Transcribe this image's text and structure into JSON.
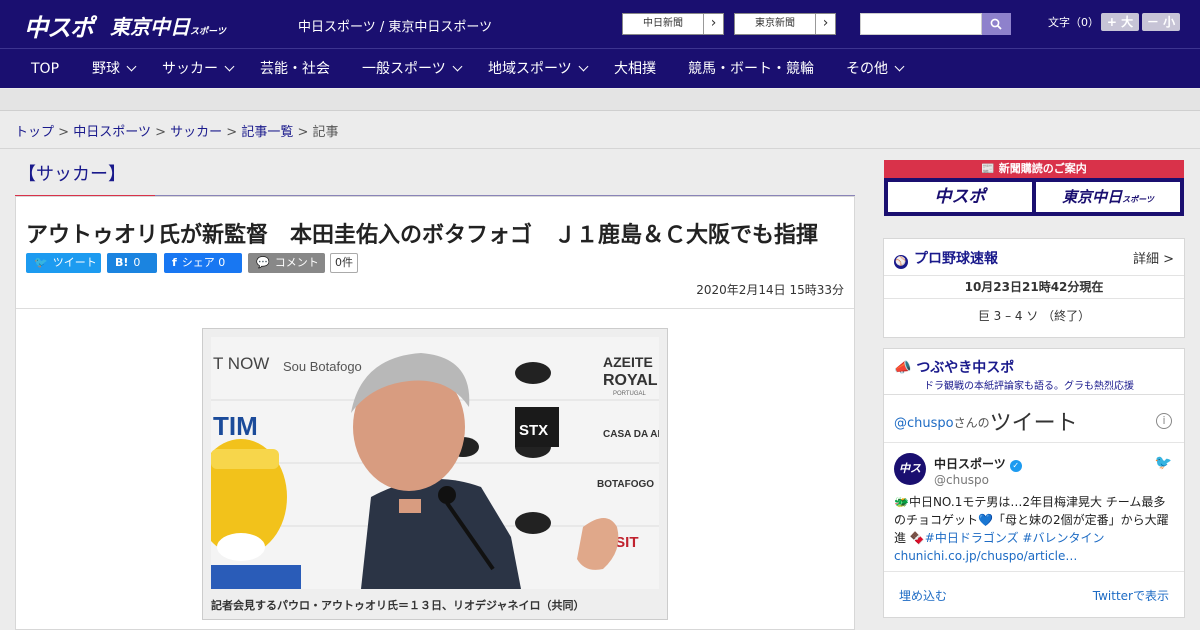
{
  "header": {
    "logo_chuspo": "中スポ",
    "logo_tokyo": "東京中日",
    "logo_tokyo_small": "スポーツ",
    "site_link": "中日スポーツ / 東京中日スポーツ",
    "news_buttons": [
      "中日新聞",
      "東京新聞"
    ],
    "search_placeholder": "",
    "font_label": "文字（0）",
    "font_plus": "+ 大",
    "font_minus": "－ 小"
  },
  "nav": [
    {
      "label": "TOP"
    },
    {
      "label": "野球"
    },
    {
      "label": "サッカー"
    },
    {
      "label": "芸能・社会"
    },
    {
      "label": "一般スポーツ"
    },
    {
      "label": "地域スポーツ"
    },
    {
      "label": "大相撲"
    },
    {
      "label": "競馬・ボート・競輪"
    },
    {
      "label": "その他"
    }
  ],
  "breadcrumb": [
    "トップ",
    "中日スポーツ",
    "サッカー",
    "記事一覧",
    "記事"
  ],
  "breadcrumb_sep": ">",
  "section_title": "【サッカー】",
  "article": {
    "headline": "アウトゥオリ氏が新監督　本田圭佑入のボタフォゴ　Ｊ１鹿島＆Ｃ大阪でも指揮",
    "share": {
      "tweet": "ツイート",
      "hatena_icon": "B!",
      "hatena_count": "0",
      "fb_icon": "f",
      "fb_label": "シェア",
      "fb_count": "0",
      "comment": "コメント",
      "comment_count": "0件"
    },
    "date": "2020年2月14日 15時33分",
    "photo_sponsors": [
      "T NOW",
      "Sou Botafogo",
      "AZEITE",
      "ROYAL",
      "PORTUGAL",
      "TIM",
      "STX",
      "CASA DA APOSTA",
      "BOTAFOGO",
      "VISIT"
    ],
    "caption": "記者会見するパウロ・アウトゥオリ氏＝１３日、リオデジャネイロ（共同）"
  },
  "sidebar": {
    "ad_top": "新聞購読のご案内",
    "ad_chuspo": "中スポ",
    "ad_tokyo": "東京中日",
    "ad_tokyo_small": "スポーツ",
    "baseball": {
      "title": "プロ野球速報",
      "more": "詳細 >",
      "time": "10月23日21時42分現在",
      "score": "巨 3 – 4 ソ （終了）"
    },
    "tweets": {
      "title": "つぶやき中スポ",
      "subtitle": "ドラ観戦の本紙評論家も語る。グラも熱烈応援",
      "account": "@chuspo",
      "account_suffix": "さんの",
      "heading": "ツイート",
      "avatar": "中スポ",
      "name": "中日スポーツ",
      "handle": "@chuspo",
      "text": "🐲中日NO.1モテ男は…2年目梅津晃大 チーム最多のチョコゲット💙「母と妹の2個が定番」から大躍進 🍫",
      "hashtags": "#中日ドラゴンズ #バレンタイン",
      "link": "chunichi.co.jp/chuspo/article…",
      "embed": "埋め込む",
      "view": "Twitterで表示"
    }
  },
  "colors": {
    "navy": "#1a0f70",
    "accent_red": "#d9324a",
    "link_blue": "#1a1a8c",
    "twitter": "#1d9bf0"
  }
}
